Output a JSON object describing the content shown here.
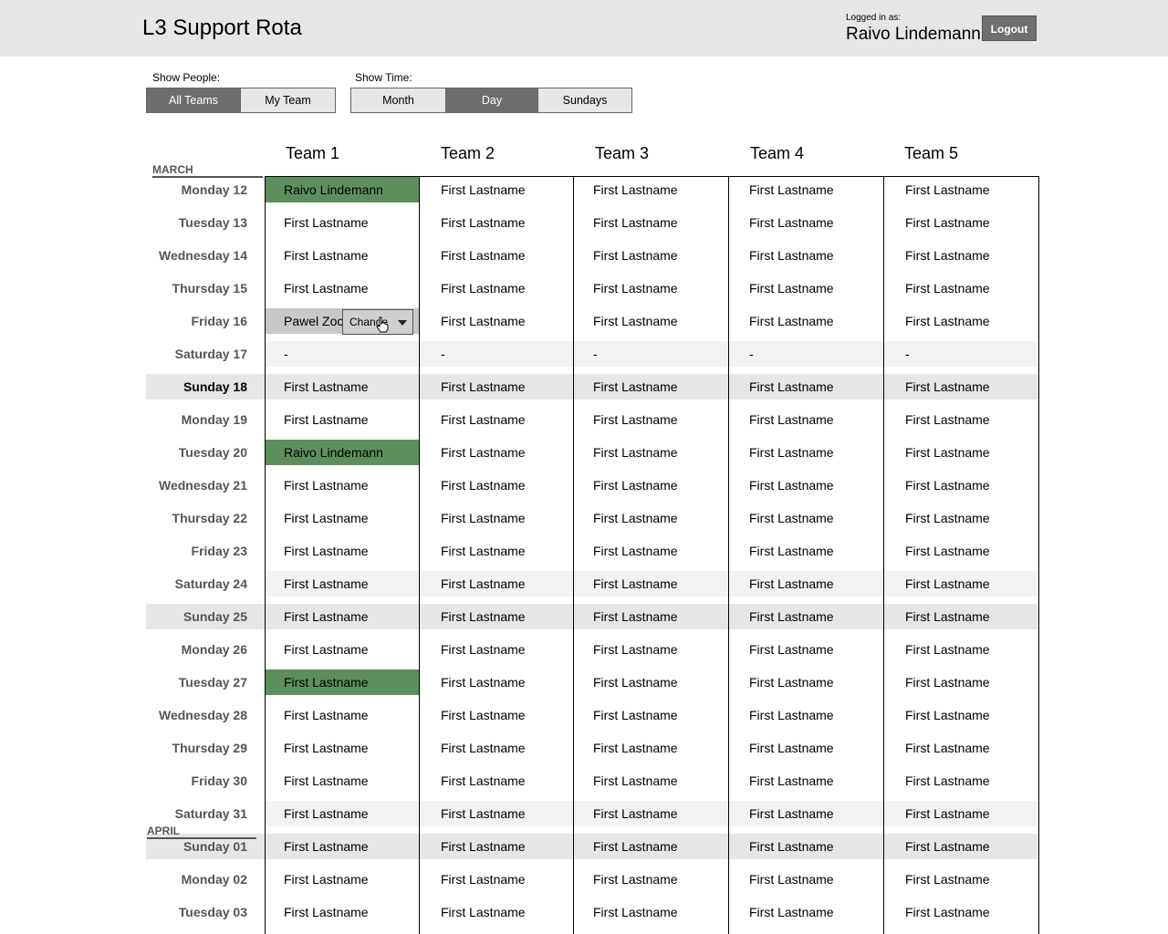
{
  "app": {
    "title": "L3 Support Rota"
  },
  "user": {
    "logged_in_label": "Logged in as:",
    "name": "Raivo Lindemann",
    "logout_label": "Logout"
  },
  "filters": {
    "people_label": "Show People:",
    "people_options": [
      "All Teams",
      "My Team"
    ],
    "people_selected": "All Teams",
    "time_label": "Show Time:",
    "time_options": [
      "Month",
      "Day",
      "Sundays"
    ],
    "time_selected": "Day"
  },
  "teams": [
    "Team 1",
    "Team 2",
    "Team 3",
    "Team 4",
    "Team 5"
  ],
  "months": [
    "MARCH",
    "APRIL"
  ],
  "change_dropdown": {
    "label": "Change"
  },
  "colors": {
    "highlight": "#5c8f5c",
    "header_bg": "#e6e6e6",
    "active_btn": "#6e6e6e",
    "weekend_bg": "#f2f2f2",
    "sunday_bg": "#e6e6e6"
  },
  "rows": [
    {
      "day": "Monday 12",
      "type": "weekday",
      "cells": [
        "Raivo Lindemann",
        "First Lastname",
        "First Lastname",
        "First Lastname",
        "First Lastname"
      ],
      "highlight": [
        0
      ]
    },
    {
      "day": "Tuesday 13",
      "type": "weekday",
      "cells": [
        "First Lastname",
        "First Lastname",
        "First Lastname",
        "First Lastname",
        "First Lastname"
      ]
    },
    {
      "day": "Wednesday 14",
      "type": "weekday",
      "cells": [
        "First Lastname",
        "First Lastname",
        "First Lastname",
        "First Lastname",
        "First Lastname"
      ]
    },
    {
      "day": "Thursday 15",
      "type": "weekday",
      "cells": [
        "First Lastname",
        "First Lastname",
        "First Lastname",
        "First Lastname",
        "First Lastname"
      ]
    },
    {
      "day": "Friday 16",
      "type": "weekday",
      "cells": [
        "Pawel Zoc",
        "First Lastname",
        "First Lastname",
        "First Lastname",
        "First Lastname"
      ],
      "selected": [
        0
      ]
    },
    {
      "day": "Saturday 17",
      "type": "saturday",
      "cells": [
        "-",
        "-",
        "-",
        "-",
        "-"
      ]
    },
    {
      "day": "Sunday 18",
      "type": "sunday",
      "bold": true,
      "cells": [
        "First Lastname",
        "First Lastname",
        "First Lastname",
        "First Lastname",
        "First Lastname"
      ]
    },
    {
      "day": "Monday 19",
      "type": "weekday",
      "cells": [
        "First Lastname",
        "First Lastname",
        "First Lastname",
        "First Lastname",
        "First Lastname"
      ]
    },
    {
      "day": "Tuesday 20",
      "type": "weekday",
      "cells": [
        "Raivo Lindemann",
        "First Lastname",
        "First Lastname",
        "First Lastname",
        "First Lastname"
      ],
      "highlight": [
        0
      ]
    },
    {
      "day": "Wednesday 21",
      "type": "weekday",
      "cells": [
        "First Lastname",
        "First Lastname",
        "First Lastname",
        "First Lastname",
        "First Lastname"
      ]
    },
    {
      "day": "Thursday 22",
      "type": "weekday",
      "cells": [
        "First Lastname",
        "First Lastname",
        "First Lastname",
        "First Lastname",
        "First Lastname"
      ]
    },
    {
      "day": "Friday 23",
      "type": "weekday",
      "cells": [
        "First Lastname",
        "First Lastname",
        "First Lastname",
        "First Lastname",
        "First Lastname"
      ]
    },
    {
      "day": "Saturday 24",
      "type": "saturday",
      "cells": [
        "First Lastname",
        "First Lastname",
        "First Lastname",
        "First Lastname",
        "First Lastname"
      ]
    },
    {
      "day": "Sunday 25",
      "type": "sunday",
      "cells": [
        "First Lastname",
        "First Lastname",
        "First Lastname",
        "First Lastname",
        "First Lastname"
      ]
    },
    {
      "day": "Monday 26",
      "type": "weekday",
      "cells": [
        "First Lastname",
        "First Lastname",
        "First Lastname",
        "First Lastname",
        "First Lastname"
      ]
    },
    {
      "day": "Tuesday 27",
      "type": "weekday",
      "cells": [
        "First Lastname",
        "First Lastname",
        "First Lastname",
        "First Lastname",
        "First Lastname"
      ],
      "highlight": [
        0
      ]
    },
    {
      "day": "Wednesday 28",
      "type": "weekday",
      "cells": [
        "First Lastname",
        "First Lastname",
        "First Lastname",
        "First Lastname",
        "First Lastname"
      ]
    },
    {
      "day": "Thursday 29",
      "type": "weekday",
      "cells": [
        "First Lastname",
        "First Lastname",
        "First Lastname",
        "First Lastname",
        "First Lastname"
      ]
    },
    {
      "day": "Friday 30",
      "type": "weekday",
      "cells": [
        "First Lastname",
        "First Lastname",
        "First Lastname",
        "First Lastname",
        "First Lastname"
      ]
    },
    {
      "day": "Saturday 31",
      "type": "saturday",
      "cells": [
        "First Lastname",
        "First Lastname",
        "First Lastname",
        "First Lastname",
        "First Lastname"
      ]
    },
    {
      "day": "Sunday 01",
      "type": "sunday",
      "cells": [
        "First Lastname",
        "First Lastname",
        "First Lastname",
        "First Lastname",
        "First Lastname"
      ]
    },
    {
      "day": "Monday 02",
      "type": "weekday",
      "cells": [
        "First Lastname",
        "First Lastname",
        "First Lastname",
        "First Lastname",
        "First Lastname"
      ]
    },
    {
      "day": "Tuesday 03",
      "type": "weekday",
      "cells": [
        "First Lastname",
        "First Lastname",
        "First Lastname",
        "First Lastname",
        "First Lastname"
      ]
    }
  ]
}
